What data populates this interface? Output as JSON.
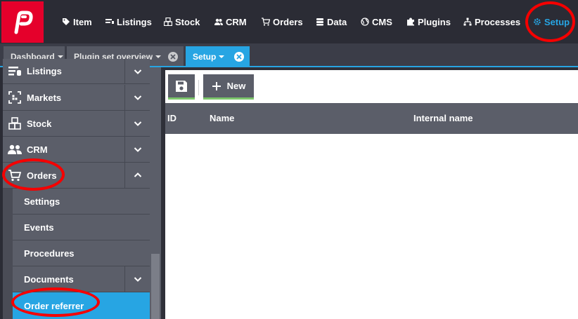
{
  "topnav": {
    "items": [
      {
        "label": "Item",
        "icon": "tag-icon"
      },
      {
        "label": "Listings",
        "icon": "listings-icon"
      },
      {
        "label": "Stock",
        "icon": "boxes-icon"
      },
      {
        "label": "CRM",
        "icon": "users-icon"
      },
      {
        "label": "Orders",
        "icon": "cart-icon"
      },
      {
        "label": "Data",
        "icon": "database-icon"
      },
      {
        "label": "CMS",
        "icon": "globe-icon"
      },
      {
        "label": "Plugins",
        "icon": "puzzle-icon"
      },
      {
        "label": "Processes",
        "icon": "sitemap-icon"
      },
      {
        "label": "Setup",
        "icon": "gear-icon",
        "active": true
      }
    ]
  },
  "tabs": [
    {
      "label": "Dashboard"
    },
    {
      "label": "Plugin set overview"
    },
    {
      "label": "Setup",
      "active": true
    }
  ],
  "sidebar": {
    "items": [
      {
        "label": "Listings",
        "icon": "listings-icon"
      },
      {
        "label": "Markets",
        "icon": "markets-icon"
      },
      {
        "label": "Stock",
        "icon": "boxes-icon"
      },
      {
        "label": "CRM",
        "icon": "users-icon"
      },
      {
        "label": "Orders",
        "icon": "cart-icon",
        "expanded": true
      }
    ],
    "sub_items": [
      {
        "label": "Settings"
      },
      {
        "label": "Events"
      },
      {
        "label": "Procedures"
      },
      {
        "label": "Documents",
        "has_children": true
      },
      {
        "label": "Order referrer",
        "selected": true
      }
    ]
  },
  "toolbar": {
    "save_icon": "floppy-icon",
    "new_label": "New"
  },
  "grid": {
    "columns": [
      "ID",
      "Name",
      "Internal name"
    ]
  },
  "colors": {
    "accent": "#27a5e3",
    "brand": "#e5002b",
    "annotation": "#f50000",
    "success_underline": "#7cc66b"
  }
}
